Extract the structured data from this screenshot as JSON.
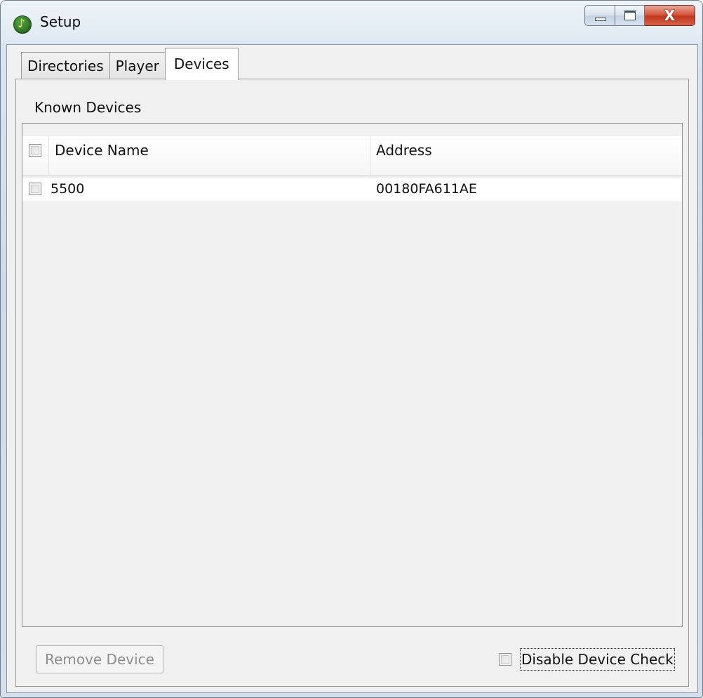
{
  "window": {
    "title": "Setup",
    "icon": "music-note-icon"
  },
  "caption_buttons": {
    "close_glyph": "X"
  },
  "tabs": [
    {
      "label": "Directories",
      "active": false
    },
    {
      "label": "Player",
      "active": false
    },
    {
      "label": "Devices",
      "active": true
    }
  ],
  "devices_panel": {
    "section_label": "Known Devices",
    "table": {
      "columns": [
        "Device Name",
        "Address"
      ],
      "rows": [
        {
          "checked": false,
          "name": "5500",
          "address": "00180FA611AE"
        }
      ]
    },
    "remove_button_label": "Remove Device",
    "remove_button_enabled": false,
    "disable_device_check": {
      "label": "Disable Device Check",
      "checked": false
    }
  }
}
